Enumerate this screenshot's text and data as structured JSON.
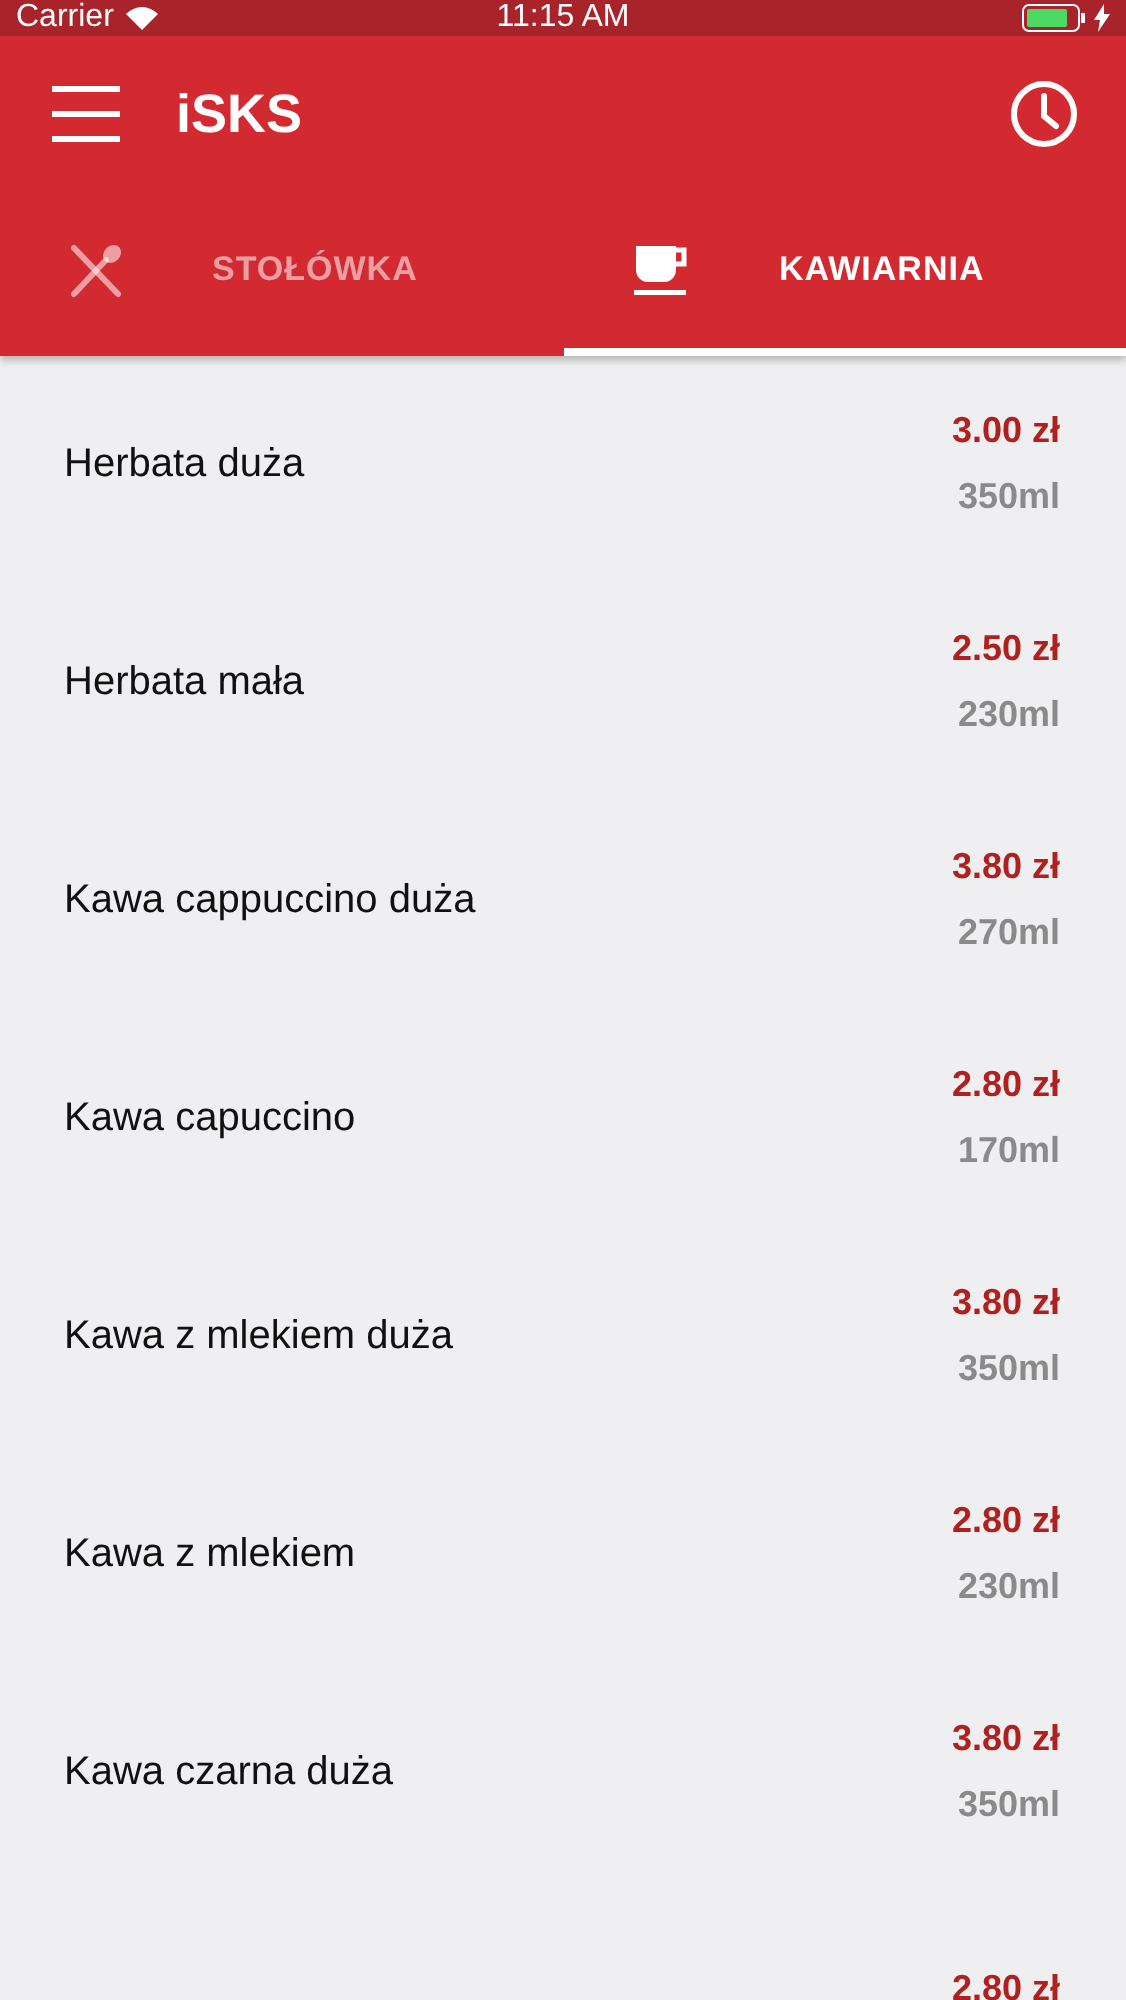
{
  "status_bar": {
    "carrier": "Carrier",
    "time": "11:15 AM"
  },
  "app_bar": {
    "title": "iSKS"
  },
  "tabs": [
    {
      "label": "STOŁÓWKA",
      "kind": "cutlery",
      "selected": false
    },
    {
      "label": "KAWIARNIA",
      "kind": "cup",
      "selected": true
    }
  ],
  "items": [
    {
      "name": "Herbata duża",
      "price": "3.00 zł",
      "volume": "350ml"
    },
    {
      "name": "Herbata mała",
      "price": "2.50 zł",
      "volume": "230ml"
    },
    {
      "name": "Kawa cappuccino duża",
      "price": "3.80 zł",
      "volume": "270ml"
    },
    {
      "name": "Kawa capuccino",
      "price": "2.80 zł",
      "volume": "170ml"
    },
    {
      "name": "Kawa z mlekiem duża",
      "price": "3.80 zł",
      "volume": "350ml"
    },
    {
      "name": "Kawa z mlekiem",
      "price": "2.80 zł",
      "volume": "230ml"
    },
    {
      "name": "Kawa czarna duża",
      "price": "3.80 zł",
      "volume": "350ml"
    },
    {
      "price": "2.80 zł"
    }
  ]
}
